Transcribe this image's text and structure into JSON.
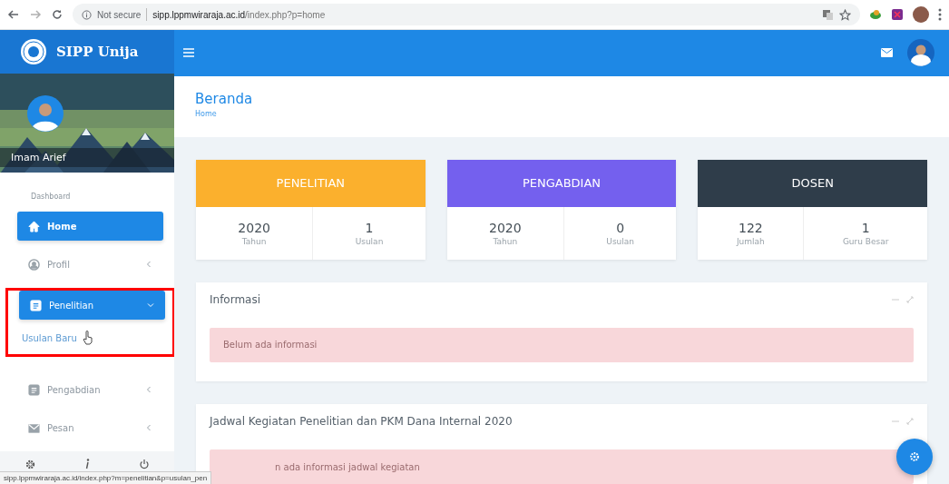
{
  "browser": {
    "security": "Not secure",
    "url_host": "sipp.lppmwiraraja.ac.id",
    "url_path": "/index.php?p=home",
    "status_url": "sipp.lppmwiraraja.ac.id/index.php?m=penelitian&p=usulan_pen"
  },
  "brand": {
    "title": "SIPP Unija"
  },
  "user": {
    "name": "Imam Arief"
  },
  "sidebar": {
    "section": "Dashboard",
    "items": [
      {
        "label": "Home",
        "selected": true
      },
      {
        "label": "Profil",
        "selected": false,
        "expanded": false
      },
      {
        "label": "Penelitian",
        "selected": false,
        "expanded": true,
        "highlighted": true,
        "children": [
          {
            "label": "Usulan Baru"
          }
        ]
      },
      {
        "label": "Pengabdian",
        "selected": false,
        "expanded": false
      },
      {
        "label": "Pesan",
        "selected": false,
        "expanded": false
      }
    ]
  },
  "page": {
    "title": "Beranda",
    "breadcrumb": "Home"
  },
  "stat_cards": [
    {
      "title": "PENELITIAN",
      "color": "#fbb02d",
      "stats": [
        {
          "value": "2020",
          "label": "Tahun"
        },
        {
          "value": "1",
          "label": "Usulan"
        }
      ]
    },
    {
      "title": "PENGABDIAN",
      "color": "#7460ee",
      "stats": [
        {
          "value": "2020",
          "label": "Tahun"
        },
        {
          "value": "0",
          "label": "Usulan"
        }
      ]
    },
    {
      "title": "DOSEN",
      "color": "#2f3d4a",
      "stats": [
        {
          "value": "122",
          "label": "Jumlah"
        },
        {
          "value": "1",
          "label": "Guru Besar"
        }
      ]
    }
  ],
  "panels": [
    {
      "title": "Informasi",
      "alert": "Belum ada informasi"
    },
    {
      "title": "Jadwal Kegiatan Penelitian dan PKM Dana Internal 2020",
      "alert": "n ada informasi jadwal kegiatan"
    }
  ]
}
